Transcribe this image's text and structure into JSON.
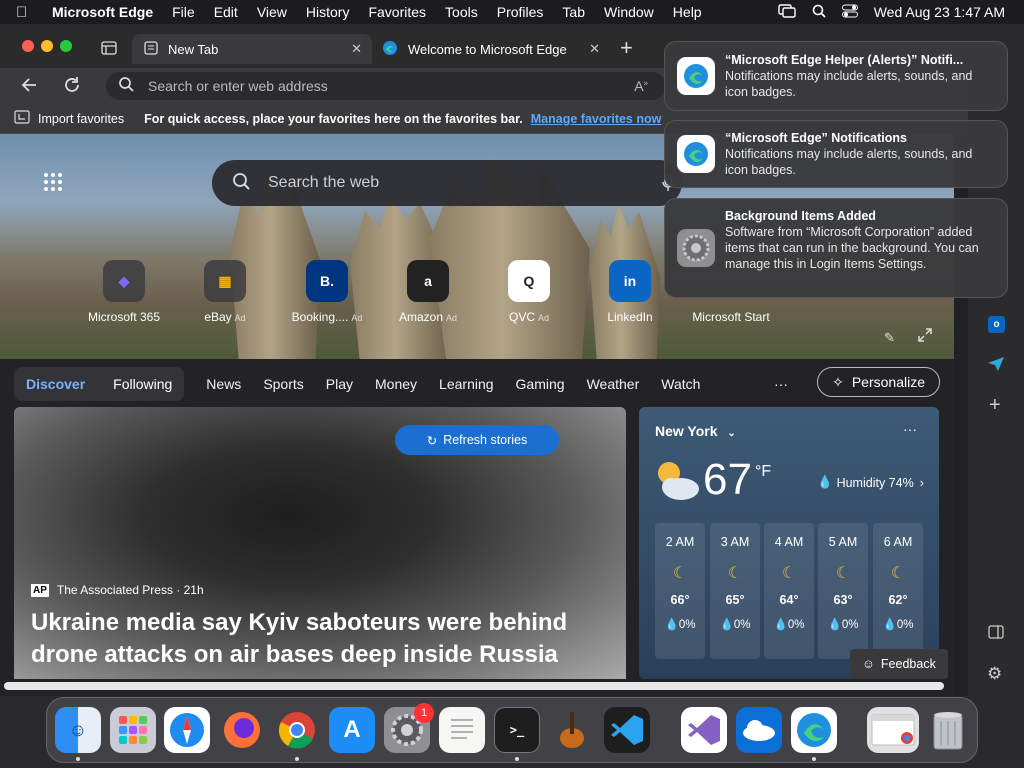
{
  "menubar": {
    "app": "Microsoft Edge",
    "items": [
      "File",
      "Edit",
      "View",
      "History",
      "Favorites",
      "Tools",
      "Profiles",
      "Tab",
      "Window",
      "Help"
    ],
    "datetime": "Wed Aug 23  1:47 AM"
  },
  "tabs": [
    {
      "label": "New Tab"
    },
    {
      "label": "Welcome to Microsoft Edge"
    }
  ],
  "address": {
    "placeholder": "Search or enter web address"
  },
  "favorites": {
    "import": "Import favorites",
    "hint": "For quick access, place your favorites here on the favorites bar.",
    "manage": "Manage favorites now"
  },
  "search": {
    "placeholder": "Search the web"
  },
  "quicklinks": [
    {
      "label": "Microsoft 365",
      "ad": "",
      "glyph": "◆"
    },
    {
      "label": "eBay",
      "ad": "Ad",
      "glyph": "▦"
    },
    {
      "label": "Booking....",
      "ad": "Ad",
      "glyph": "B."
    },
    {
      "label": "Amazon",
      "ad": "Ad",
      "glyph": "a"
    },
    {
      "label": "QVC",
      "ad": "Ad",
      "glyph": "Q"
    },
    {
      "label": "LinkedIn",
      "ad": "",
      "glyph": "in"
    },
    {
      "label": "Microsoft Start",
      "ad": "",
      "glyph": ""
    }
  ],
  "feednav": {
    "pill": [
      "Discover",
      "Following"
    ],
    "items": [
      "News",
      "Sports",
      "Play",
      "Money",
      "Learning",
      "Gaming",
      "Weather",
      "Watch"
    ],
    "more": "···",
    "personalize": "Personalize"
  },
  "story": {
    "refresh": "Refresh stories",
    "source": "The Associated Press · 21h",
    "source_logo": "AP",
    "headline": "Ukraine media say Kyiv saboteurs were behind drone attacks on air bases deep inside Russia"
  },
  "weather": {
    "city": "New York",
    "temp": "67",
    "unit": "°F",
    "humidity": "Humidity 74%",
    "more": "···",
    "hours": [
      {
        "time": "2 AM",
        "temp": "66°",
        "precip": "0%"
      },
      {
        "time": "3 AM",
        "temp": "65°",
        "precip": "0%"
      },
      {
        "time": "4 AM",
        "temp": "64°",
        "precip": "0%"
      },
      {
        "time": "5 AM",
        "temp": "63°",
        "precip": "0%"
      },
      {
        "time": "6 AM",
        "temp": "62°",
        "precip": "0%"
      }
    ]
  },
  "feedback": "Feedback",
  "notifications": [
    {
      "title": "“Microsoft Edge Helper (Alerts)” Notifi...",
      "body": "Notifications may include alerts, sounds, and icon badges."
    },
    {
      "title": "“Microsoft Edge” Notifications",
      "body": "Notifications may include alerts, sounds, and icon badges."
    },
    {
      "title": "Background Items Added",
      "body": "Software from “Microsoft Corporation” added items that can run in the background. You can manage this in Login Items Settings."
    }
  ],
  "dock": {
    "settings_badge": "1",
    "apps": [
      "finder",
      "launchpad",
      "safari",
      "firefox",
      "chrome",
      "app-store",
      "system-settings",
      "textedit",
      "terminal",
      "garageband",
      "vscode",
      "visual-studio",
      "onedrive",
      "edge",
      "preview-window",
      "trash"
    ]
  },
  "colors": {
    "accent": "#1a6fd1",
    "link": "#5aa9ff",
    "discover": "#7ab2ff"
  }
}
